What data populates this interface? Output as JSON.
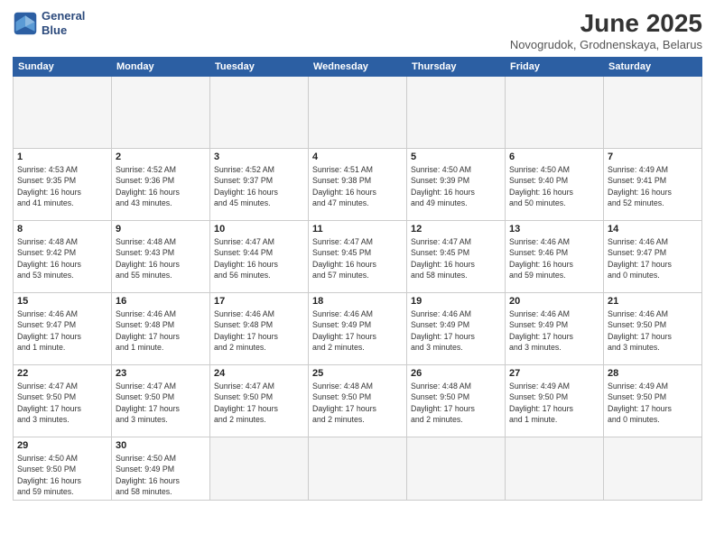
{
  "header": {
    "logo_line1": "General",
    "logo_line2": "Blue",
    "month": "June 2025",
    "location": "Novogrudok, Grodnenskaya, Belarus"
  },
  "weekdays": [
    "Sunday",
    "Monday",
    "Tuesday",
    "Wednesday",
    "Thursday",
    "Friday",
    "Saturday"
  ],
  "days": [
    {
      "num": "",
      "info": ""
    },
    {
      "num": "",
      "info": ""
    },
    {
      "num": "",
      "info": ""
    },
    {
      "num": "",
      "info": ""
    },
    {
      "num": "",
      "info": ""
    },
    {
      "num": "",
      "info": ""
    },
    {
      "num": "",
      "info": ""
    },
    {
      "num": "1",
      "info": "Sunrise: 4:53 AM\nSunset: 9:35 PM\nDaylight: 16 hours\nand 41 minutes."
    },
    {
      "num": "2",
      "info": "Sunrise: 4:52 AM\nSunset: 9:36 PM\nDaylight: 16 hours\nand 43 minutes."
    },
    {
      "num": "3",
      "info": "Sunrise: 4:52 AM\nSunset: 9:37 PM\nDaylight: 16 hours\nand 45 minutes."
    },
    {
      "num": "4",
      "info": "Sunrise: 4:51 AM\nSunset: 9:38 PM\nDaylight: 16 hours\nand 47 minutes."
    },
    {
      "num": "5",
      "info": "Sunrise: 4:50 AM\nSunset: 9:39 PM\nDaylight: 16 hours\nand 49 minutes."
    },
    {
      "num": "6",
      "info": "Sunrise: 4:50 AM\nSunset: 9:40 PM\nDaylight: 16 hours\nand 50 minutes."
    },
    {
      "num": "7",
      "info": "Sunrise: 4:49 AM\nSunset: 9:41 PM\nDaylight: 16 hours\nand 52 minutes."
    },
    {
      "num": "8",
      "info": "Sunrise: 4:48 AM\nSunset: 9:42 PM\nDaylight: 16 hours\nand 53 minutes."
    },
    {
      "num": "9",
      "info": "Sunrise: 4:48 AM\nSunset: 9:43 PM\nDaylight: 16 hours\nand 55 minutes."
    },
    {
      "num": "10",
      "info": "Sunrise: 4:47 AM\nSunset: 9:44 PM\nDaylight: 16 hours\nand 56 minutes."
    },
    {
      "num": "11",
      "info": "Sunrise: 4:47 AM\nSunset: 9:45 PM\nDaylight: 16 hours\nand 57 minutes."
    },
    {
      "num": "12",
      "info": "Sunrise: 4:47 AM\nSunset: 9:45 PM\nDaylight: 16 hours\nand 58 minutes."
    },
    {
      "num": "13",
      "info": "Sunrise: 4:46 AM\nSunset: 9:46 PM\nDaylight: 16 hours\nand 59 minutes."
    },
    {
      "num": "14",
      "info": "Sunrise: 4:46 AM\nSunset: 9:47 PM\nDaylight: 17 hours\nand 0 minutes."
    },
    {
      "num": "15",
      "info": "Sunrise: 4:46 AM\nSunset: 9:47 PM\nDaylight: 17 hours\nand 1 minute."
    },
    {
      "num": "16",
      "info": "Sunrise: 4:46 AM\nSunset: 9:48 PM\nDaylight: 17 hours\nand 1 minute."
    },
    {
      "num": "17",
      "info": "Sunrise: 4:46 AM\nSunset: 9:48 PM\nDaylight: 17 hours\nand 2 minutes."
    },
    {
      "num": "18",
      "info": "Sunrise: 4:46 AM\nSunset: 9:49 PM\nDaylight: 17 hours\nand 2 minutes."
    },
    {
      "num": "19",
      "info": "Sunrise: 4:46 AM\nSunset: 9:49 PM\nDaylight: 17 hours\nand 3 minutes."
    },
    {
      "num": "20",
      "info": "Sunrise: 4:46 AM\nSunset: 9:49 PM\nDaylight: 17 hours\nand 3 minutes."
    },
    {
      "num": "21",
      "info": "Sunrise: 4:46 AM\nSunset: 9:50 PM\nDaylight: 17 hours\nand 3 minutes."
    },
    {
      "num": "22",
      "info": "Sunrise: 4:47 AM\nSunset: 9:50 PM\nDaylight: 17 hours\nand 3 minutes."
    },
    {
      "num": "23",
      "info": "Sunrise: 4:47 AM\nSunset: 9:50 PM\nDaylight: 17 hours\nand 3 minutes."
    },
    {
      "num": "24",
      "info": "Sunrise: 4:47 AM\nSunset: 9:50 PM\nDaylight: 17 hours\nand 2 minutes."
    },
    {
      "num": "25",
      "info": "Sunrise: 4:48 AM\nSunset: 9:50 PM\nDaylight: 17 hours\nand 2 minutes."
    },
    {
      "num": "26",
      "info": "Sunrise: 4:48 AM\nSunset: 9:50 PM\nDaylight: 17 hours\nand 2 minutes."
    },
    {
      "num": "27",
      "info": "Sunrise: 4:49 AM\nSunset: 9:50 PM\nDaylight: 17 hours\nand 1 minute."
    },
    {
      "num": "28",
      "info": "Sunrise: 4:49 AM\nSunset: 9:50 PM\nDaylight: 17 hours\nand 0 minutes."
    },
    {
      "num": "29",
      "info": "Sunrise: 4:50 AM\nSunset: 9:50 PM\nDaylight: 16 hours\nand 59 minutes."
    },
    {
      "num": "30",
      "info": "Sunrise: 4:50 AM\nSunset: 9:49 PM\nDaylight: 16 hours\nand 58 minutes."
    },
    {
      "num": "",
      "info": ""
    },
    {
      "num": "",
      "info": ""
    },
    {
      "num": "",
      "info": ""
    },
    {
      "num": "",
      "info": ""
    },
    {
      "num": "",
      "info": ""
    }
  ]
}
